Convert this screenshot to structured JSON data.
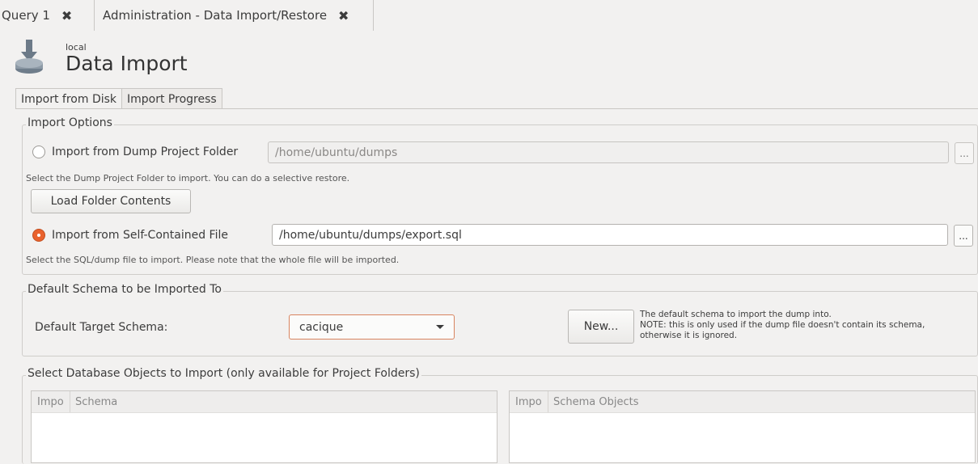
{
  "doc_tabs": [
    {
      "label": "Query 1",
      "close_icon": "✖"
    },
    {
      "label": "Administration - Data Import/Restore",
      "close_icon": "✖"
    }
  ],
  "header": {
    "connection": "local",
    "title": "Data Import",
    "icon": "download-disk-icon"
  },
  "subtabs": [
    "Import from Disk",
    "Import Progress"
  ],
  "import_options": {
    "legend": "Import Options",
    "dump_folder": {
      "label": "Import from Dump Project Folder",
      "path": "/home/ubuntu/dumps",
      "browse": "...",
      "hint": "Select the Dump Project Folder to import. You can do a selective restore.",
      "selected": false
    },
    "load_button": "Load Folder Contents",
    "self_contained": {
      "label": "Import from Self-Contained File",
      "path": "/home/ubuntu/dumps/export.sql",
      "browse": "...",
      "hint": "Select the SQL/dump file to import. Please note that the whole file will be imported.",
      "selected": true
    }
  },
  "default_schema": {
    "legend": "Default Schema to be Imported To",
    "label": "Default Target Schema:",
    "selected": "cacique",
    "new_button": "New...",
    "note": [
      "The default schema to import the dump into.",
      "NOTE: this is only used if the dump file doesn't contain its schema,",
      "otherwise it is ignored."
    ]
  },
  "objects": {
    "legend": "Select Database Objects to Import (only available for Project Folders)",
    "schema_table": {
      "col1": "Impo",
      "col2": "Schema"
    },
    "objects_table": {
      "col1": "Impo",
      "col2": "Schema Objects"
    }
  },
  "colors": {
    "accent": "#e9622d",
    "background": "#f2f1f0"
  }
}
